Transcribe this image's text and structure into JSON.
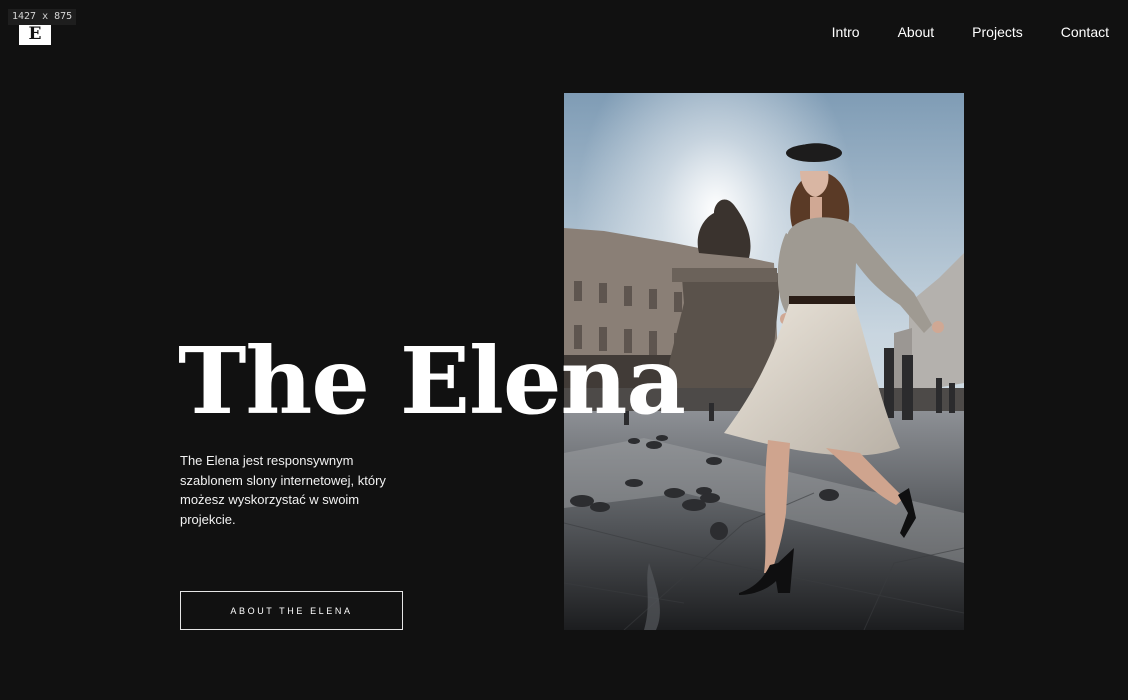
{
  "overlay": {
    "dimensions": "1427 x 875"
  },
  "header": {
    "logo_letter": "E",
    "nav": [
      {
        "label": "Intro"
      },
      {
        "label": "About"
      },
      {
        "label": "Projects"
      },
      {
        "label": "Contact"
      }
    ]
  },
  "hero": {
    "title": "The Elena",
    "description": "The Elena jest responsywnym szablonem slony internetowej, który możesz wyskorzystać w swoim projekcie.",
    "cta_label": "ABOUT THE ELENA"
  },
  "colors": {
    "background": "#111111",
    "text": "#ffffff"
  }
}
